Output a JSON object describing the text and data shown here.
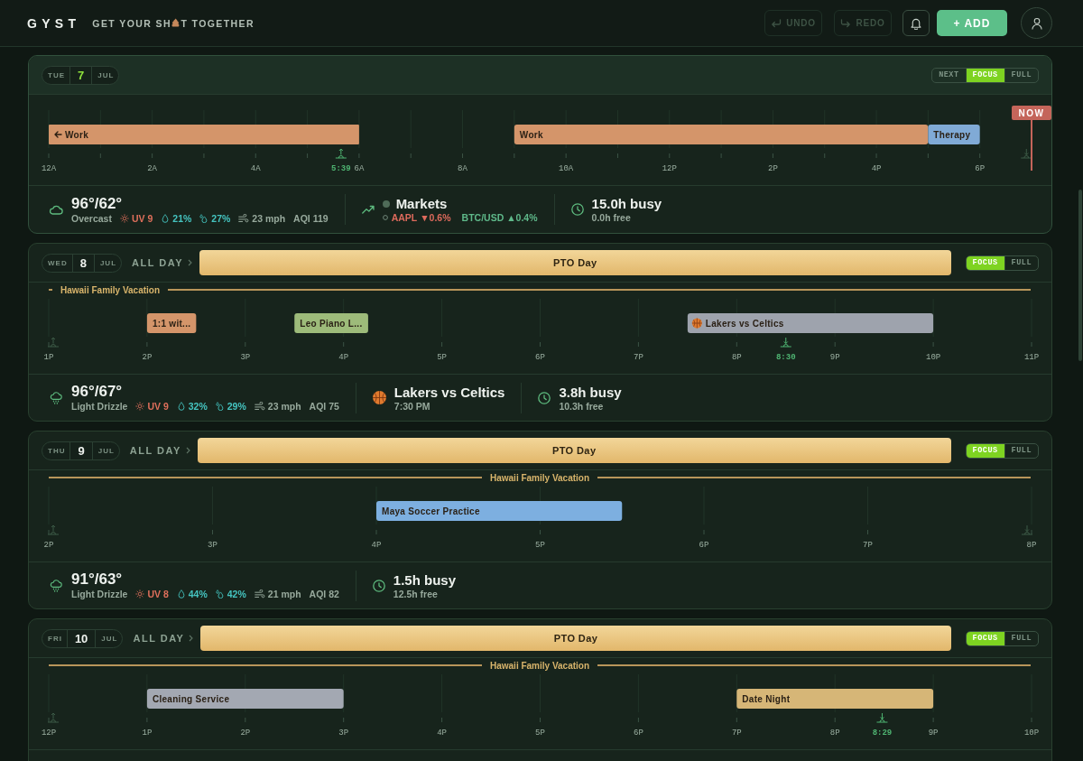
{
  "header": {
    "brand": "GYST",
    "tagline": {
      "before": "GET YOUR SH",
      "after": "T TOGETHER"
    },
    "buttons": [
      {
        "kind": "undo",
        "label": "UNDO",
        "disabled": true
      },
      {
        "kind": "redo",
        "label": "REDO",
        "disabled": true
      },
      {
        "kind": "notifications",
        "disabled": false
      },
      {
        "kind": "add",
        "label": "+ ADD",
        "disabled": false
      },
      {
        "kind": "profile",
        "disabled": false
      }
    ]
  },
  "days": [
    {
      "weekday": "TUE",
      "day": "7",
      "month": "JUL",
      "today": true,
      "views": [
        {
          "label": "NEXT",
          "selected": false
        },
        {
          "label": "FOCUS",
          "selected": true
        },
        {
          "label": "FULL",
          "selected": false
        }
      ],
      "timeline": {
        "axis_labels": [
          "12A",
          "2A",
          "4A",
          "6A",
          "8A",
          "10A",
          "12P",
          "2P",
          "4P",
          "6P"
        ],
        "events": [
          {
            "label": "Work",
            "color": "#d4956a",
            "kind": "event",
            "continued": true
          },
          {
            "label": "Work",
            "color": "#d4956a",
            "kind": "event",
            "continued": false
          },
          {
            "label": "Therapy",
            "color": "#80aad6",
            "kind": "event",
            "continued": false
          }
        ],
        "markers": [
          {
            "kind": "sunrise",
            "label": "5:39"
          },
          {
            "kind": "sunset"
          },
          {
            "kind": "now",
            "label": "NOW"
          }
        ]
      },
      "stats": [
        {
          "kind": "weather",
          "raining": false,
          "temperature": "96°/62°",
          "condition": "Overcast",
          "uv": "UV 9",
          "humidity": "21%",
          "precipitation": "27%",
          "wind": "23 mph",
          "aqi": "AQI 119"
        },
        {
          "kind": "markets",
          "title": "Markets",
          "tickers": [
            {
              "symbol": "AAPL",
              "change": "▼0.6%",
              "rising": false
            },
            {
              "symbol": "BTC/USD",
              "change": "▲0.4%",
              "rising": true
            }
          ]
        },
        {
          "kind": "busy",
          "busy": "15.0h busy",
          "free": "0.0h free"
        }
      ]
    },
    {
      "weekday": "WED",
      "day": "8",
      "month": "JUL",
      "today": false,
      "all_day": {
        "label": "ALL DAY",
        "event": "PTO Day"
      },
      "views": [
        {
          "label": "FOCUS",
          "selected": true
        },
        {
          "label": "FULL",
          "selected": false
        }
      ],
      "vacation": {
        "label": "Hawaii Family Vacation",
        "kind": "starts"
      },
      "timeline": {
        "axis_labels": [
          "1P",
          "2P",
          "3P",
          "4P",
          "5P",
          "6P",
          "7P",
          "8P",
          "9P",
          "10P",
          "11P"
        ],
        "events": [
          {
            "label": "1:1 wit...",
            "color": "#d4956a",
            "kind": "event",
            "continued": false
          },
          {
            "label": "Leo Piano L...",
            "color": "#9dbb7a",
            "kind": "event",
            "continued": false
          },
          {
            "label": "Lakers vs Celtics",
            "color": "#9ea3ad",
            "kind": "game",
            "continued": false
          }
        ],
        "markers": [
          {
            "kind": "sunrise"
          },
          {
            "kind": "sunset",
            "label": "8:30"
          }
        ]
      },
      "stats": [
        {
          "kind": "weather",
          "raining": true,
          "temperature": "96°/67°",
          "condition": "Light Drizzle",
          "uv": "UV 9",
          "humidity": "32%",
          "precipitation": "29%",
          "wind": "23 mph",
          "aqi": "AQI 75"
        },
        {
          "kind": "game",
          "title": "Lakers vs Celtics",
          "time": "7:30 PM"
        },
        {
          "kind": "busy",
          "busy": "3.8h busy",
          "free": "10.3h free"
        }
      ]
    },
    {
      "weekday": "THU",
      "day": "9",
      "month": "JUL",
      "today": false,
      "all_day": {
        "label": "ALL DAY",
        "event": "PTO Day"
      },
      "views": [
        {
          "label": "FOCUS",
          "selected": true
        },
        {
          "label": "FULL",
          "selected": false
        }
      ],
      "vacation": {
        "label": "Hawaii Family Vacation",
        "kind": "ongoing"
      },
      "timeline": {
        "axis_labels": [
          "2P",
          "3P",
          "4P",
          "5P",
          "6P",
          "7P",
          "8P"
        ],
        "events": [
          {
            "label": "Maya Soccer Practice",
            "color": "#7dafe0",
            "kind": "event",
            "continued": false
          }
        ],
        "markers": [
          {
            "kind": "sunrise"
          },
          {
            "kind": "sunset"
          }
        ]
      },
      "stats": [
        {
          "kind": "weather",
          "raining": true,
          "temperature": "91°/63°",
          "condition": "Light Drizzle",
          "uv": "UV 8",
          "humidity": "44%",
          "precipitation": "42%",
          "wind": "21 mph",
          "aqi": "AQI 82"
        },
        {
          "kind": "busy",
          "busy": "1.5h busy",
          "free": "12.5h free"
        }
      ]
    },
    {
      "weekday": "FRI",
      "day": "10",
      "month": "JUL",
      "today": false,
      "all_day": {
        "label": "ALL DAY",
        "event": "PTO Day"
      },
      "views": [
        {
          "label": "FOCUS",
          "selected": true
        },
        {
          "label": "FULL",
          "selected": false
        }
      ],
      "vacation": {
        "label": "Hawaii Family Vacation",
        "kind": "ongoing"
      },
      "timeline": {
        "axis_labels": [
          "12P",
          "1P",
          "2P",
          "3P",
          "4P",
          "5P",
          "6P",
          "7P",
          "8P",
          "9P",
          "10P"
        ],
        "events": [
          {
            "label": "Cleaning Service",
            "color": "#a3a8b2",
            "kind": "event",
            "continued": false
          },
          {
            "label": "Date Night",
            "color": "#d6b677",
            "kind": "event",
            "continued": false
          }
        ],
        "markers": [
          {
            "kind": "sunrise"
          },
          {
            "kind": "sunset",
            "label": "8:29"
          }
        ]
      }
    }
  ]
}
